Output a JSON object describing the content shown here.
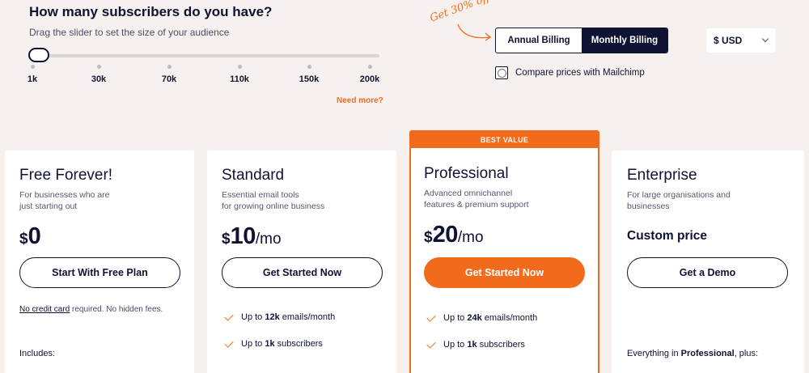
{
  "slider": {
    "heading": "How many subscribers do you have?",
    "subheading": "Drag the slider to set the size of your audience",
    "ticks": [
      "1k",
      "30k",
      "70k",
      "110k",
      "150k",
      "200k"
    ],
    "value": "1k",
    "need_more": "Need more?"
  },
  "promo": "Get 30% off",
  "billing": {
    "options": [
      "Annual Billing",
      "Monthly Billing"
    ],
    "selected": "Monthly Billing"
  },
  "currency": "$ USD",
  "compare_label": "Compare prices with Mailchimp",
  "best_value_label": "BEST VALUE",
  "plans": [
    {
      "title": "Free Forever!",
      "desc": [
        "For businesses who are",
        "just starting out"
      ],
      "currency": "$",
      "amount": "0",
      "cta": "Start With Free Plan",
      "note_link": "No credit card",
      "note_rest": " required. No hidden fees.",
      "includes": "Includes:"
    },
    {
      "title": "Standard",
      "desc": [
        "Essential email tools",
        "for growing online business"
      ],
      "currency": "$",
      "amount": "10",
      "period": "/mo",
      "cta": "Get Started Now",
      "features": [
        {
          "pre": "Up to ",
          "bold": "12k",
          "post": " emails/month"
        },
        {
          "pre": "Up to ",
          "bold": "1k",
          "post": " subscribers"
        }
      ]
    },
    {
      "title": "Professional",
      "desc": [
        "Advanced omnichannel",
        "features & premium support"
      ],
      "currency": "$",
      "amount": "20",
      "period": "/mo",
      "cta": "Get Started Now",
      "features": [
        {
          "pre": "Up to ",
          "bold": "24k",
          "post": " emails/month"
        },
        {
          "pre": "Up to ",
          "bold": "1k",
          "post": " subscribers"
        }
      ]
    },
    {
      "title": "Enterprise",
      "desc": [
        "For large organisations and",
        "businesses"
      ],
      "price_text": "Custom price",
      "cta": "Get a Demo",
      "includes_pre": "Everything in ",
      "includes_bold": "Professional",
      "includes_post": ", plus:"
    }
  ],
  "colors": {
    "accent": "#f26b1d",
    "navy": "#0f1233",
    "background": "#f6f1ee"
  }
}
